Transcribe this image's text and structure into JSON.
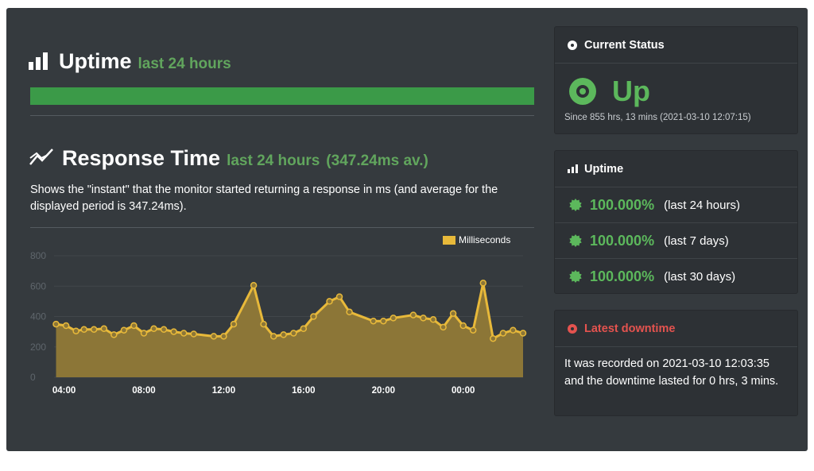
{
  "uptime_section": {
    "title": "Uptime",
    "subtitle": "last 24 hours"
  },
  "response_section": {
    "title": "Response Time",
    "subtitle": "last 24 hours",
    "average": "(347.24ms av.)",
    "description": "Shows the \"instant\" that the monitor started returning a response in ms (and average for the displayed period is 347.24ms)."
  },
  "chart_data": {
    "type": "area",
    "legend": "Milliseconds",
    "legend_position": "top-right",
    "ylim": [
      0,
      800
    ],
    "y_ticks": [
      "800",
      "600",
      "400",
      "200",
      "0"
    ],
    "x_ticks": [
      "04:00",
      "08:00",
      "12:00",
      "16:00",
      "20:00",
      "00:00"
    ],
    "x_tick_hours": [
      4,
      8,
      12,
      16,
      20,
      24
    ],
    "x_range_hours": [
      3.5,
      27.0
    ],
    "x_hours": [
      3.6,
      4.1,
      4.6,
      5.0,
      5.5,
      6.0,
      6.5,
      7.0,
      7.5,
      8.0,
      8.5,
      9.0,
      9.5,
      10.0,
      10.5,
      11.5,
      12.0,
      12.5,
      13.5,
      14.0,
      14.5,
      15.0,
      15.5,
      16.0,
      16.5,
      17.3,
      17.8,
      18.3,
      19.5,
      20.0,
      20.5,
      21.5,
      22.0,
      22.5,
      23.0,
      23.5,
      24.0,
      24.5,
      25.0,
      25.5,
      26.0,
      26.5,
      27.0
    ],
    "values": [
      350,
      340,
      305,
      315,
      315,
      320,
      280,
      310,
      340,
      290,
      320,
      315,
      300,
      290,
      285,
      270,
      270,
      350,
      605,
      350,
      270,
      280,
      290,
      320,
      400,
      500,
      530,
      430,
      370,
      370,
      390,
      410,
      390,
      380,
      330,
      420,
      340,
      310,
      620,
      255,
      290,
      310,
      290
    ],
    "colors": {
      "line": "#e8b93a",
      "fill": "#8c7637",
      "grid": "#41464a",
      "axis_text": "#5f666c",
      "x_text": "#ffffff"
    }
  },
  "status_card": {
    "header": "Current Status",
    "status": "Up",
    "since": "Since 855 hrs, 13 mins (2021-03-10 12:07:15)"
  },
  "uptime_card": {
    "header": "Uptime",
    "rows": [
      {
        "percent": "100.000%",
        "period": "(last 24 hours)"
      },
      {
        "percent": "100.000%",
        "period": "(last 7 days)"
      },
      {
        "percent": "100.000%",
        "period": "(last 30 days)"
      }
    ]
  },
  "downtime_card": {
    "header": "Latest downtime",
    "text": "It was recorded on 2021-03-10 12:03:35 and the downtime lasted for 0 hrs, 3 mins."
  },
  "colors": {
    "panel_bg": "#353a3e",
    "accent_green": "#5cb85c",
    "uptime_bar": "#3b9a48",
    "alert_red": "#e4534f"
  },
  "icons": {
    "uptime": "bar-chart-icon",
    "response": "line-chart-icon",
    "status": "dot-circle-icon",
    "uptime_row": "gear-badge-icon",
    "downtime": "dot-circle-icon"
  }
}
